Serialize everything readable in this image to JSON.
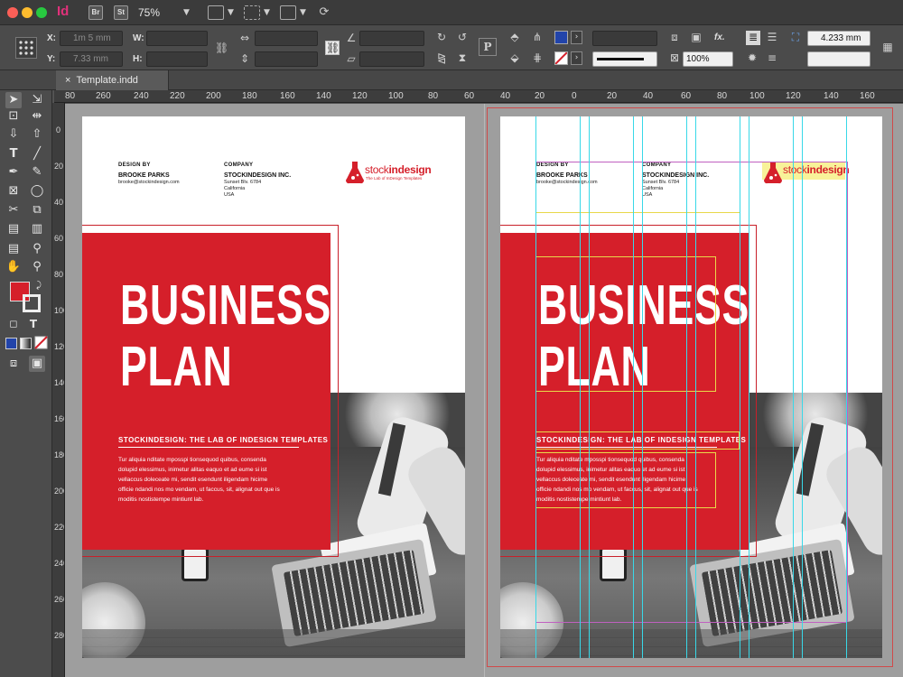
{
  "app": {
    "icon": "Id",
    "bridge_label": "Br",
    "stock_label": "St",
    "zoom": "75%"
  },
  "control_panel": {
    "x_label": "X:",
    "y_label": "Y:",
    "w_label": "W:",
    "h_label": "H:",
    "x_value": "1m 5 mm",
    "y_value": "7.33 mm",
    "stroke_weight": "4.233 mm",
    "opacity": "100%",
    "fx_label": "fx."
  },
  "tab": {
    "title": "Template.indd"
  },
  "ruler": {
    "h_labels": [
      "80",
      "260",
      "240",
      "220",
      "200",
      "180",
      "160",
      "140",
      "120",
      "100",
      "80",
      "60",
      "40",
      "20",
      "0",
      "20",
      "40",
      "60",
      "80",
      "100",
      "120",
      "140",
      "160",
      "180",
      "200",
      "220",
      "240",
      "260"
    ],
    "v_labels": [
      "0",
      "20",
      "40",
      "60",
      "80",
      "100",
      "120",
      "140",
      "160",
      "180",
      "200",
      "220",
      "240",
      "260",
      "280"
    ]
  },
  "document": {
    "design_by_label": "DESIGN BY",
    "designer_name": "BROOKE PARKS",
    "designer_email": "brooke@stockindesign.com",
    "company_label": "COMPANY",
    "company_name": "STOCKINDESIGN INC.",
    "address_1": "Sunset Blv. 6784",
    "address_2": "California",
    "address_3": "USA",
    "brand_stock": "stock",
    "brand_indesign": "indesign",
    "brand_tagline": "The Lab of InDesign Templates",
    "title_line1": "BUSINESS",
    "title_line2": "PLAN",
    "subtitle": "STOCKINDESIGN: THE LAB OF INDESIGN TEMPLATES",
    "body_lines": [
      "Tur aliquia nditate mposspi tionsequod quibus, consenda",
      "dolupid elessimus, inimetur alitas eaquo et ad eume si ist",
      "vellaccus doleceate mi, sendit esendunt iligendam hicime",
      "officie ndandi nos mo vendam, ut faccus, sit, alignat out que is",
      "moditis nostistempe mintiunt lab."
    ]
  },
  "colors": {
    "accent_red": "#d51f2a",
    "guide_cyan": "#38d8e8",
    "guide_magenta": "#c060c0",
    "frame_yellow": "#e8d84a"
  }
}
